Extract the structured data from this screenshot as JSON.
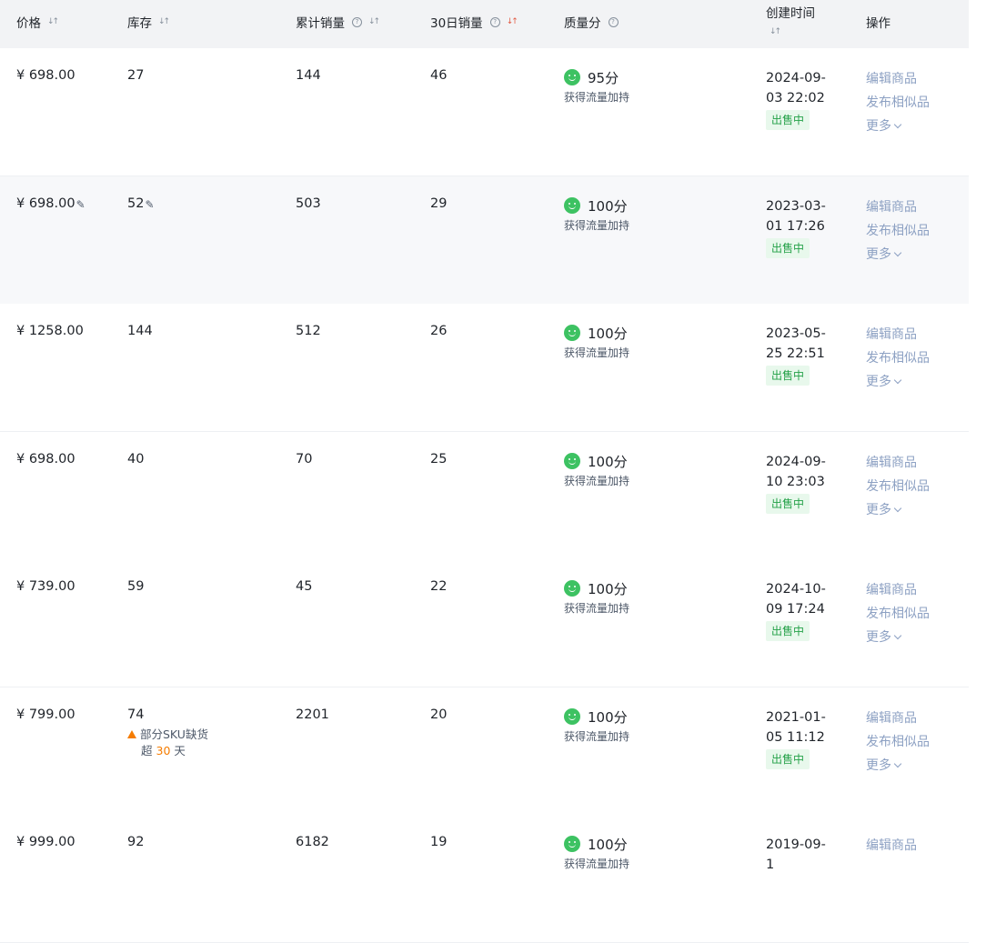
{
  "columns": {
    "price": "价格",
    "stock": "库存",
    "total_sales": "累计销量",
    "sales_30d": "30日销量",
    "quality": "质量分",
    "created": "创建时间",
    "ops": "操作"
  },
  "quality_subtitle": "获得流量加持",
  "status_label": "出售中",
  "ops_labels": {
    "edit": "编辑商品",
    "publish_similar": "发布相似品",
    "more": "更多"
  },
  "rows": [
    {
      "price": "¥ 698.00",
      "stock": "27",
      "total": "144",
      "sales30": "46",
      "score": "95分",
      "created": "2024-09-03 22:02",
      "editable": false
    },
    {
      "price": "¥ 698.00",
      "stock": "52",
      "total": "503",
      "sales30": "29",
      "score": "100分",
      "created": "2023-03-01 17:26",
      "editable": true
    },
    {
      "price": "¥ 1258.00",
      "stock": "144",
      "total": "512",
      "sales30": "26",
      "score": "100分",
      "created": "2023-05-25 22:51",
      "editable": false
    },
    {
      "price": "¥ 698.00",
      "stock": "40",
      "total": "70",
      "sales30": "25",
      "score": "100分",
      "created": "2024-09-10 23:03",
      "editable": false
    },
    {
      "price": "¥ 739.00",
      "stock": "59",
      "total": "45",
      "sales30": "22",
      "score": "100分",
      "created": "2024-10-09 17:24",
      "editable": false
    },
    {
      "price": "¥ 799.00",
      "stock": "74",
      "total": "2201",
      "sales30": "20",
      "score": "100分",
      "created": "2021-01-05 11:12",
      "editable": false,
      "warning": {
        "text": "部分SKU缺货",
        "prefix": "超",
        "days": "30",
        "suffix": "天"
      }
    },
    {
      "price": "¥ 999.00",
      "stock": "92",
      "total": "6182",
      "sales30": "19",
      "score": "100分",
      "created": "2019-09-1",
      "editable": false
    }
  ]
}
